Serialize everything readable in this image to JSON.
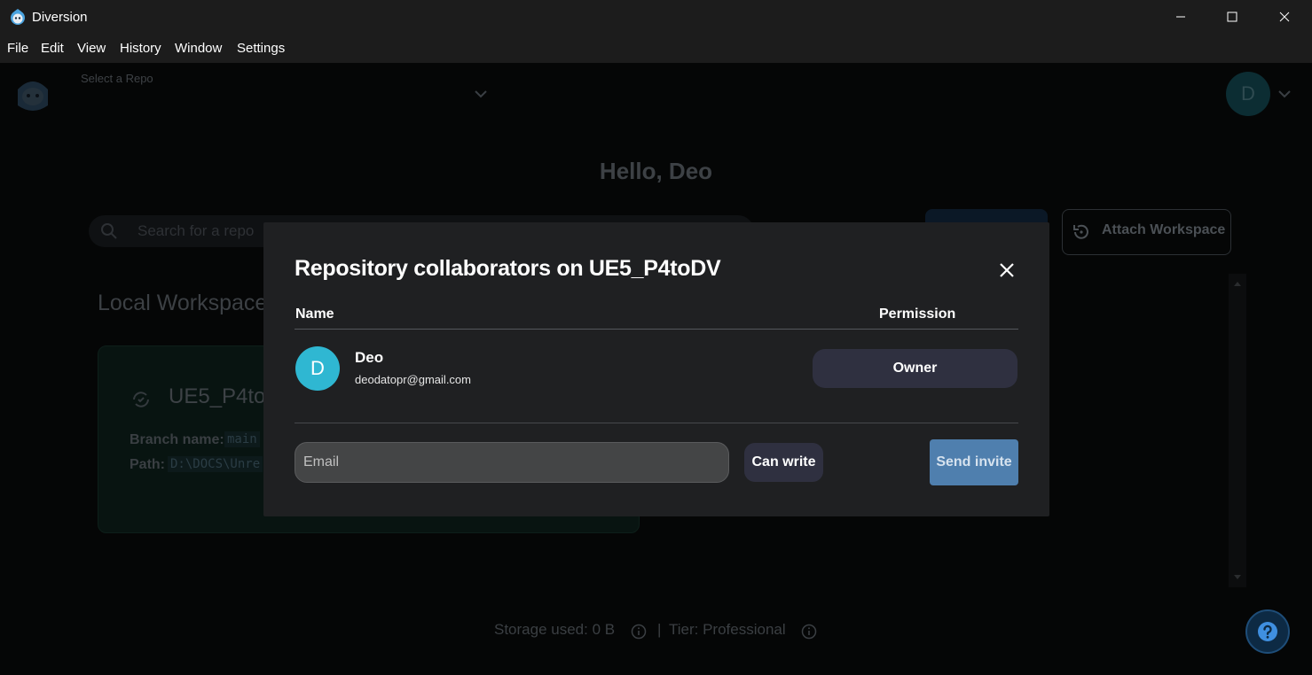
{
  "window": {
    "title": "Diversion"
  },
  "menu": [
    "File",
    "Edit",
    "View",
    "History",
    "Window",
    "Settings"
  ],
  "header": {
    "repo_select_label": "Select a Repo",
    "avatar_initial": "D"
  },
  "home": {
    "greeting": "Hello, Deo",
    "search_placeholder": "Search for a repo",
    "attach_workspace_label": "Attach Workspace",
    "local_workspaces_title": "Local Workspace",
    "workspace": {
      "name": "UE5_P4to",
      "branch_label": "Branch name:",
      "branch_value": "main",
      "path_label": "Path:",
      "path_value": "D:\\DOCS\\Unre"
    },
    "footer": {
      "storage": "Storage used: 0 B",
      "separator": "|",
      "tier": "Tier: Professional"
    }
  },
  "dialog": {
    "title": "Repository collaborators on UE5_P4toDV",
    "col_name": "Name",
    "col_permission": "Permission",
    "collaborators": [
      {
        "initial": "D",
        "name": "Deo",
        "email": "deodatopr@gmail.com",
        "permission": "Owner"
      }
    ],
    "email_placeholder": "Email",
    "permission_select": "Can write",
    "send_invite": "Send invite"
  },
  "colors": {
    "avatar": "#2fb7d2",
    "send_invite": "#4f7fae",
    "chip": "#2f3040",
    "dialog_bg": "#1f2022"
  },
  "icons": [
    "app-logo-icon",
    "minimize-icon",
    "maximize-icon",
    "close-icon",
    "sloth-logo-icon",
    "chevron-down-icon",
    "search-icon",
    "attach-icon",
    "sync-icon",
    "info-icon",
    "help-icon"
  ]
}
